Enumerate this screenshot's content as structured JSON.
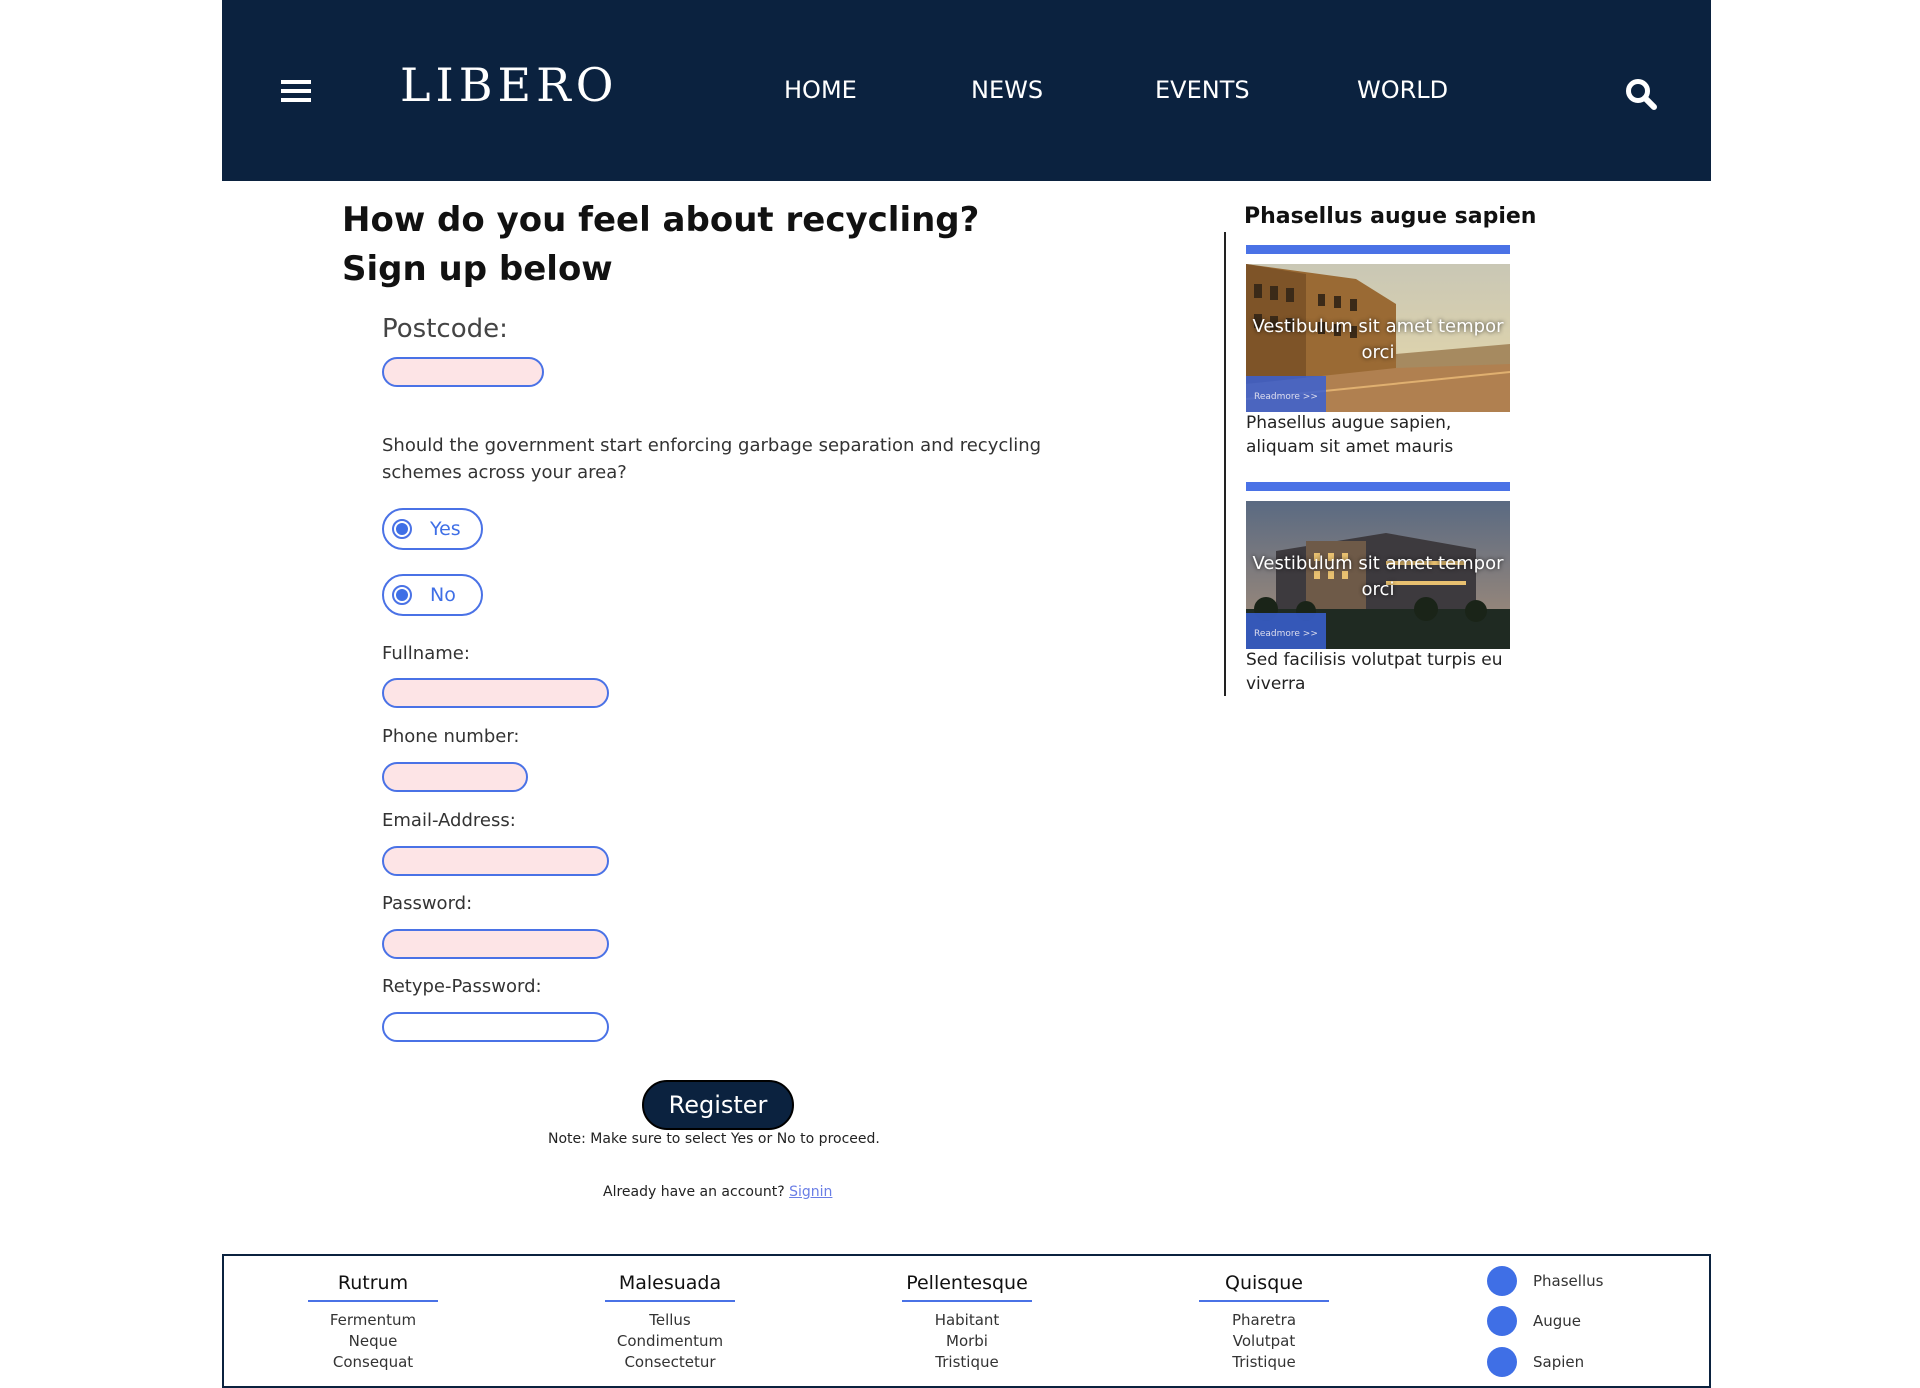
{
  "header": {
    "logo": "LIBERO",
    "nav": [
      "HOME",
      "NEWS",
      "EVENTS",
      "WORLD"
    ]
  },
  "form": {
    "title_line1": "How do you feel about recycling?",
    "title_line2": "Sign up below",
    "postcode_label": "Postcode:",
    "question": "Should the government start enforcing garbage separation and recycling schemes across your area?",
    "yes_label": "Yes",
    "no_label": "No",
    "fullname_label": "Fullname:",
    "phone_label": "Phone number:",
    "email_label": "Email-Address:",
    "password_label": "Password:",
    "retype_label": "Retype-Password:",
    "register_label": "Register",
    "note": "Note: Make sure to select Yes or No to proceed.",
    "already_text": "Already have an account?",
    "signin_label": "Signin"
  },
  "aside": {
    "title": "Phasellus augue sapien",
    "cards": [
      {
        "overlay": "Vestibulum sit amet tempor orci",
        "readmore": "Readmore >>",
        "caption": "Phasellus augue sapien, aliquam sit amet mauris"
      },
      {
        "overlay": "Vestibulum sit amet tempor orci",
        "readmore": "Readmore >>",
        "caption": "Sed facilisis volutpat turpis eu viverra"
      }
    ]
  },
  "footer": {
    "columns": [
      {
        "heading": "Rutrum",
        "items": [
          "Fermentum",
          "Neque",
          "Consequat"
        ]
      },
      {
        "heading": "Malesuada",
        "items": [
          "Tellus",
          "Condimentum",
          "Consectetur"
        ]
      },
      {
        "heading": "Pellentesque",
        "items": [
          "Habitant",
          "Morbi",
          "Tristique"
        ]
      },
      {
        "heading": "Quisque",
        "items": [
          "Pharetra",
          "Volutpat",
          "Tristique"
        ]
      }
    ],
    "social": [
      "Phasellus",
      "Augue",
      "Sapien"
    ]
  },
  "colors": {
    "header_bg": "#0b223f",
    "accent": "#4a72e6",
    "input_bg": "#fde4e6"
  }
}
